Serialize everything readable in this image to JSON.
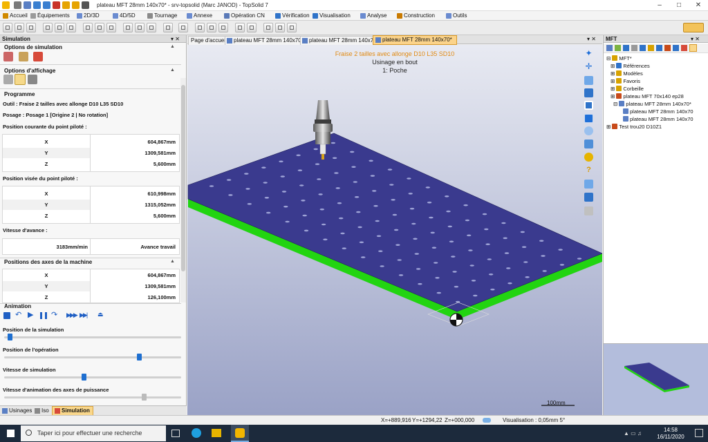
{
  "window": {
    "title": "plateau MFT 28mm 140x70* - srv-topsolid (Marc JANOD) - TopSolid 7"
  },
  "menu": [
    "Accueil",
    "Équipements",
    "2D/3D",
    "4D/5D",
    "Tournage",
    "Annexe",
    "Opération CN",
    "Vérification",
    "Visualisation",
    "Analyse",
    "Construction",
    "Outils"
  ],
  "simulation_panel": {
    "title": "Simulation",
    "options_simulation": "Options de simulation",
    "options_affichage": "Options d'affichage",
    "programme": "Programme",
    "outil": "Outil : Fraise 2 tailles avec allonge D10 L35 SD10",
    "posage": "Posage : Posage 1 [Origine 2 | No rotation]",
    "pos_courante": "Position courante du point piloté :",
    "pos_visee": "Position visée du point piloté :",
    "vitesse_avance": "Vitesse d'avance :",
    "positions_axes": "Positions des axes de la machine",
    "animation": "Animation",
    "x": "X",
    "y": "Y",
    "z": "Z",
    "current": {
      "x": "604,867mm",
      "y": "1309,581mm",
      "z": "5,600mm"
    },
    "target": {
      "x": "610,998mm",
      "y": "1315,052mm",
      "z": "5,600mm"
    },
    "feed": {
      "value": "3183mm/min",
      "mode": "Avance travail"
    },
    "axes": {
      "x": "604,867mm",
      "y": "1309,581mm",
      "z": "126,100mm"
    },
    "slider_pos_sim": "Position de la simulation",
    "slider_pos_op": "Position de l'opération",
    "slider_vitesse_sim": "Vitesse de simulation",
    "slider_vitesse_axes": "Vitesse d'animation des axes de puissance",
    "slider_values": {
      "pos_sim": 0.02,
      "pos_op": 0.77,
      "vitesse_sim": 0.45,
      "vitesse_axes": 0.8
    },
    "bottom_tabs": [
      "Usinages",
      "Iso",
      "Simulation"
    ]
  },
  "doc_tabs": [
    "Page d'accueil",
    "plateau MFT 28mm 140x70",
    "plateau MFT 28mm 140x70",
    "plateau MFT 28mm 140x70*"
  ],
  "viewport": {
    "line1": "Fraise 2 tailles avec allonge D10 L35 SD10",
    "line2": "Usinage en bout",
    "line3": "1: Poche",
    "scale": "100mm",
    "plate_color": "#3a3a8e",
    "edge_color": "#22d411",
    "bg_top": "#e8eaf2",
    "bg_bottom": "#9aa2c6"
  },
  "mft_panel": {
    "title": "MFT",
    "tree": [
      "MFT*",
      "Références",
      "Modèles",
      "Favoris",
      "Corbeille",
      "plateau MFT 70x140 ep28",
      "plateau MFT 28mm 140x70*",
      "plateau MFT 28mm 140x70",
      "plateau MFT 28mm 140x70",
      "Test trou20 D10Z1"
    ]
  },
  "status": {
    "x": "X=+889,916",
    "y": "Y=+1294,22",
    "z": "Z=+000,000",
    "visu": "Visualisation : 0,05mm 5°"
  },
  "taskbar": {
    "search": "Taper ici pour effectuer une recherche",
    "time": "14:58",
    "date": "16/11/2020"
  }
}
